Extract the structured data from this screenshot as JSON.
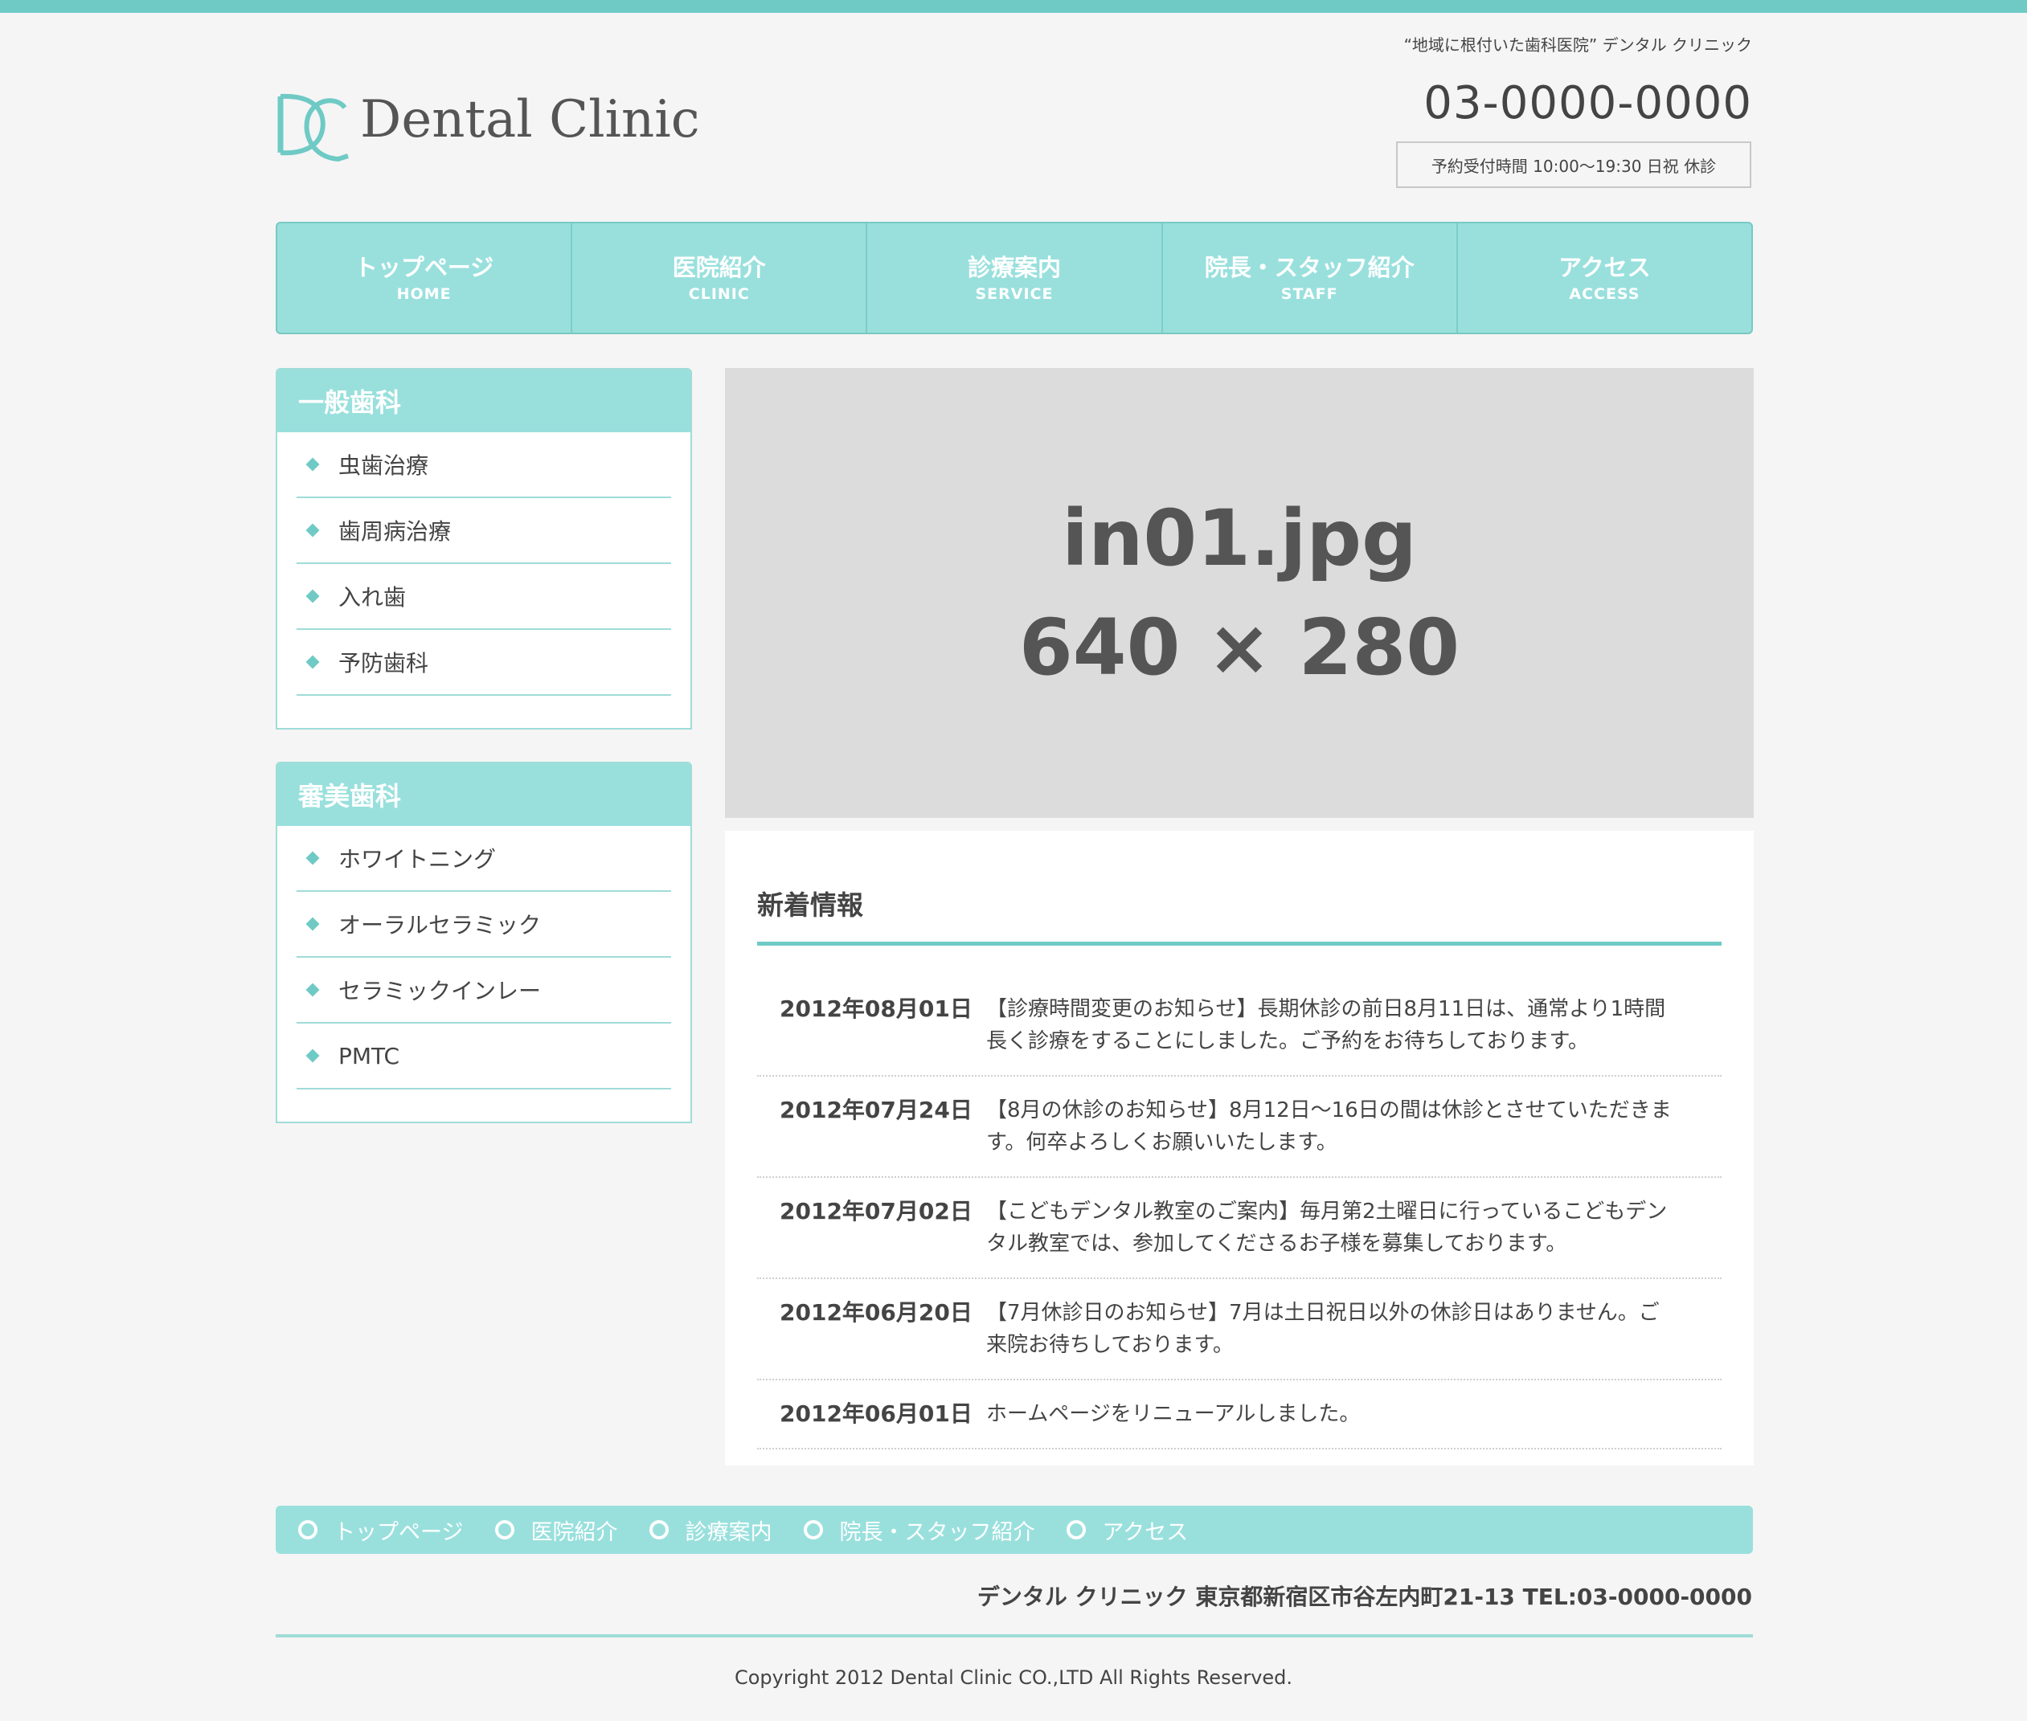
{
  "header": {
    "tagline": "“地域に根付いた歯科医院” デンタル クリニック",
    "logo_text": "Dental Clinic",
    "phone": "03-0000-0000",
    "hours": "予約受付時間 10:00〜19:30 日祝 休診"
  },
  "nav": [
    {
      "jp": "トップページ",
      "en": "HOME"
    },
    {
      "jp": "医院紹介",
      "en": "CLINIC"
    },
    {
      "jp": "診療案内",
      "en": "SERVICE"
    },
    {
      "jp": "院長・スタッフ紹介",
      "en": "STAFF"
    },
    {
      "jp": "アクセス",
      "en": "ACCESS"
    }
  ],
  "sidebar": [
    {
      "title": "一般歯科",
      "items": [
        "虫歯治療",
        "歯周病治療",
        "入れ歯",
        "予防歯科"
      ]
    },
    {
      "title": "審美歯科",
      "items": [
        "ホワイトニング",
        "オーラルセラミック",
        "セラミックインレー",
        "PMTC"
      ]
    }
  ],
  "hero": {
    "line1": "in01.jpg",
    "line2": "640 × 280"
  },
  "news": {
    "title": "新着情報",
    "items": [
      {
        "date": "2012年08月01日",
        "text": "【診療時間変更のお知らせ】長期休診の前日8月11日は、通常より1時間長く診療をすることにしました。ご予約をお待ちしております。"
      },
      {
        "date": "2012年07月24日",
        "text": "【8月の休診のお知らせ】8月12日〜16日の間は休診とさせていただきます。何卒よろしくお願いいたします。"
      },
      {
        "date": "2012年07月02日",
        "text": "【こどもデンタル教室のご案内】毎月第2土曜日に行っているこどもデンタル教室では、参加してくださるお子様を募集しております。"
      },
      {
        "date": "2012年06月20日",
        "text": "【7月休診日のお知らせ】7月は土日祝日以外の休診日はありません。ご来院お待ちしております。"
      },
      {
        "date": "2012年06月01日",
        "text": "ホームページをリニューアルしました。"
      }
    ]
  },
  "footer": {
    "nav": [
      "トップページ",
      "医院紹介",
      "診療案内",
      "院長・スタッフ紹介",
      "アクセス"
    ],
    "address": "デンタル クリニック 東京都新宿区市谷左内町21-13 TEL:03-0000-0000",
    "copyright": "Copyright 2012 Dental Clinic CO.,LTD All Rights Reserved."
  },
  "colors": {
    "accent": "#6fcac5",
    "nav_bg": "#99e0dd",
    "page_bg": "#f5f5f5",
    "placeholder_bg": "#dcdcdc"
  },
  "icons": {
    "logo_mark": "dc-monogram-logo",
    "list_bullet": "diamond-icon",
    "footer_bullet": "ring-icon"
  }
}
